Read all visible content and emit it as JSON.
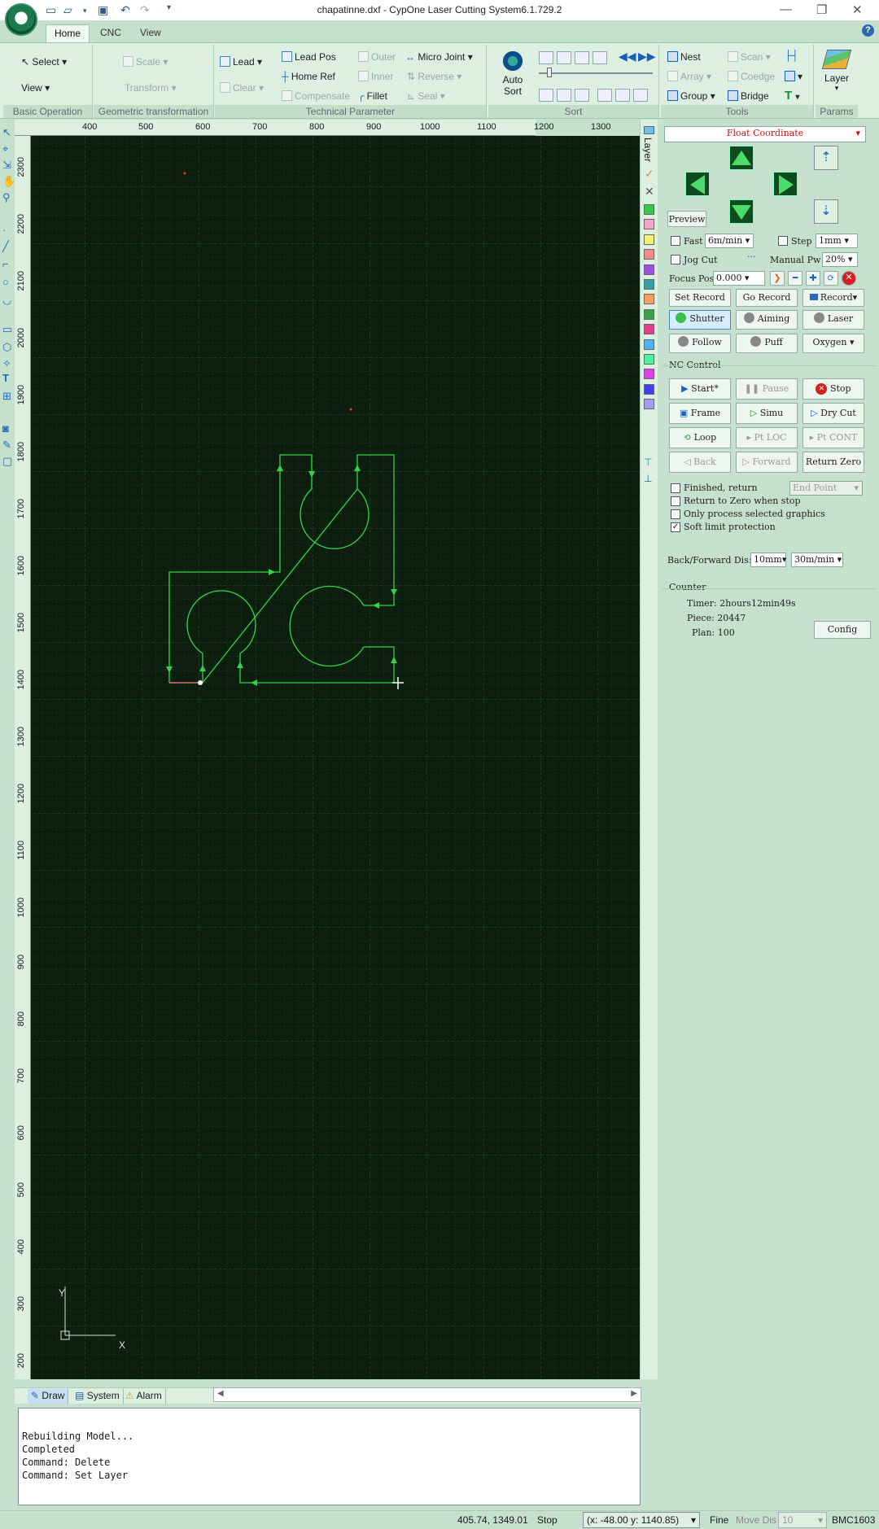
{
  "window": {
    "title": "chapatinne.dxf - CypOne Laser Cutting System6.1.729.2"
  },
  "tabs": [
    "Home",
    "CNC",
    "View"
  ],
  "active_tab": "Home",
  "ribbon": {
    "basic": {
      "select": "Select",
      "view": "View",
      "title": "Basic Operation"
    },
    "geom": {
      "scale": "Scale",
      "transform": "Transform",
      "title": "Geometric transformation"
    },
    "tech": {
      "lead": "Lead",
      "clear": "Clear",
      "lead_pos": "Lead Pos",
      "home_ref": "Home Ref",
      "compensate": "Compensate",
      "outer": "Outer",
      "inner": "Inner",
      "fillet": "Fillet",
      "micro_joint": "Micro Joint",
      "reverse": "Reverse",
      "seal": "Seal",
      "title": "Technical Parameter"
    },
    "sort": {
      "auto_sort": "Auto",
      "auto_sort2": "Sort",
      "title": "Sort"
    },
    "tools": {
      "nest": "Nest",
      "array": "Array",
      "group": "Group",
      "scan": "Scan",
      "coedge": "Coedge",
      "bridge": "Bridge",
      "title": "Tools"
    },
    "params": {
      "layer": "Layer",
      "title": "Params"
    }
  },
  "ruler": {
    "x": [
      "400",
      "500",
      "600",
      "700",
      "800",
      "900",
      "1000",
      "1100",
      "1200",
      "1300"
    ],
    "y": [
      "2300",
      "2200",
      "2100",
      "2000",
      "1900",
      "1800",
      "1700",
      "1600",
      "1500",
      "1400",
      "1300",
      "1200",
      "1100",
      "1000",
      "900",
      "800",
      "700",
      "600",
      "500",
      "400",
      "300",
      "200"
    ]
  },
  "layer_label": "Layer",
  "layer_colors": [
    "#39c64a",
    "#f4a6c8",
    "#f5ef7a",
    "#f08c8c",
    "#9b4fe3",
    "#35a0a0",
    "#f4a060",
    "#3aa04a",
    "#e0408a",
    "#50b0f0",
    "#50f0a0",
    "#e040e0",
    "#4040f0",
    "#a0a0f0"
  ],
  "canvas": {
    "axis_y": "Y",
    "axis_x": "X"
  },
  "panel": {
    "coord_mode": "Float Coordinate",
    "preview": "Preview",
    "fast": "Fast",
    "fast_speed": "6m/min",
    "step": "Step",
    "step_val": "1mm",
    "jog_cut": "Jog Cut",
    "manual_pw": "Manual Pw",
    "manual_pw_val": "20%",
    "focus_pos": "Focus Pos",
    "focus_val": "0.000",
    "set_record": "Set Record",
    "go_record": "Go Record",
    "record": "Record",
    "shutter": "Shutter",
    "aiming": "Aiming",
    "laser": "Laser",
    "follow": "Follow",
    "puff": "Puff",
    "oxygen": "Oxygen",
    "nc_control": "NC Control",
    "start": "Start*",
    "pause": "Pause",
    "stop": "Stop",
    "frame": "Frame",
    "simu": "Simu",
    "dry_cut": "Dry Cut",
    "loop": "Loop",
    "pt_loc": "Pt LOC",
    "pt_cont": "Pt CONT",
    "back": "Back",
    "forward": "Forward",
    "return_zero": "Return Zero",
    "finished_return": "Finished, return",
    "end_point": "End Point",
    "return_zero_stop": "Return to Zero when stop",
    "only_selected": "Only process selected graphics",
    "soft_limit": "Soft limit protection",
    "bf_dis": "Back/Forward Dis:",
    "bf_dis_val": "10mm",
    "bf_speed": "30m/min",
    "counter": "Counter",
    "timer": "Timer: 2hours12min49s",
    "piece": "Piece: 20447",
    "plan": "Plan: 100",
    "config": "Config"
  },
  "bottom_tabs": [
    "Draw",
    "System",
    "Alarm"
  ],
  "console": [
    "Rebuilding Model...",
    "Completed",
    "Command: Delete",
    "Command: Set Layer"
  ],
  "status": {
    "coords": "405.74, 1349.01",
    "state": "Stop",
    "machine": "(x: -48.00 y: 1140.85)",
    "fine": "Fine",
    "move_dis": "Move Dis",
    "move_val": "10",
    "board": "BMC1603"
  }
}
